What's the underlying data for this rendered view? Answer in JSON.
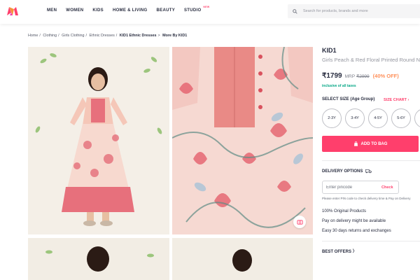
{
  "header": {
    "nav": [
      "MEN",
      "WOMEN",
      "KIDS",
      "HOME & LIVING",
      "BEAUTY",
      "STUDIO"
    ],
    "studio_badge": "NEW",
    "search_placeholder": "Search for products, brands and more"
  },
  "breadcrumb": {
    "items": [
      "Home",
      "Clothing",
      "Girls Clothing",
      "Ethnic Dresses"
    ],
    "current": "KID1 Ethnic Dresses",
    "more": "More By KID1"
  },
  "product": {
    "brand": "KID1",
    "name": "Girls Peach & Red Floral Printed Round N",
    "price": "₹1799",
    "mrp_label": "MRP",
    "mrp": "₹2999",
    "discount": "(40% OFF)",
    "tax_note": "inclusive of all taxes"
  },
  "size": {
    "heading": "SELECT SIZE (Age Group)",
    "chart_link": "SIZE CHART",
    "options": [
      "2-3Y",
      "3-4Y",
      "4-5Y",
      "5-6Y",
      "6-7"
    ]
  },
  "add_to_bag": "ADD TO BAG",
  "delivery": {
    "heading": "DELIVERY OPTIONS",
    "placeholder": "Enter pincode",
    "check": "Check",
    "note": "Please enter PIN code to check delivery time & Pay on Delivery"
  },
  "features": [
    "100% Original Products",
    "Pay on delivery might be available",
    "Easy 30 days returns and exchanges"
  ],
  "best_offers": "BEST OFFERS",
  "colors": {
    "accent": "#ff3f6c",
    "discount": "#ff905a",
    "tax": "#03a685"
  },
  "icons": [
    "myntra-logo",
    "search-icon",
    "bag-icon",
    "chevron-right-icon",
    "truck-icon",
    "tag-icon",
    "similar-icon"
  ]
}
